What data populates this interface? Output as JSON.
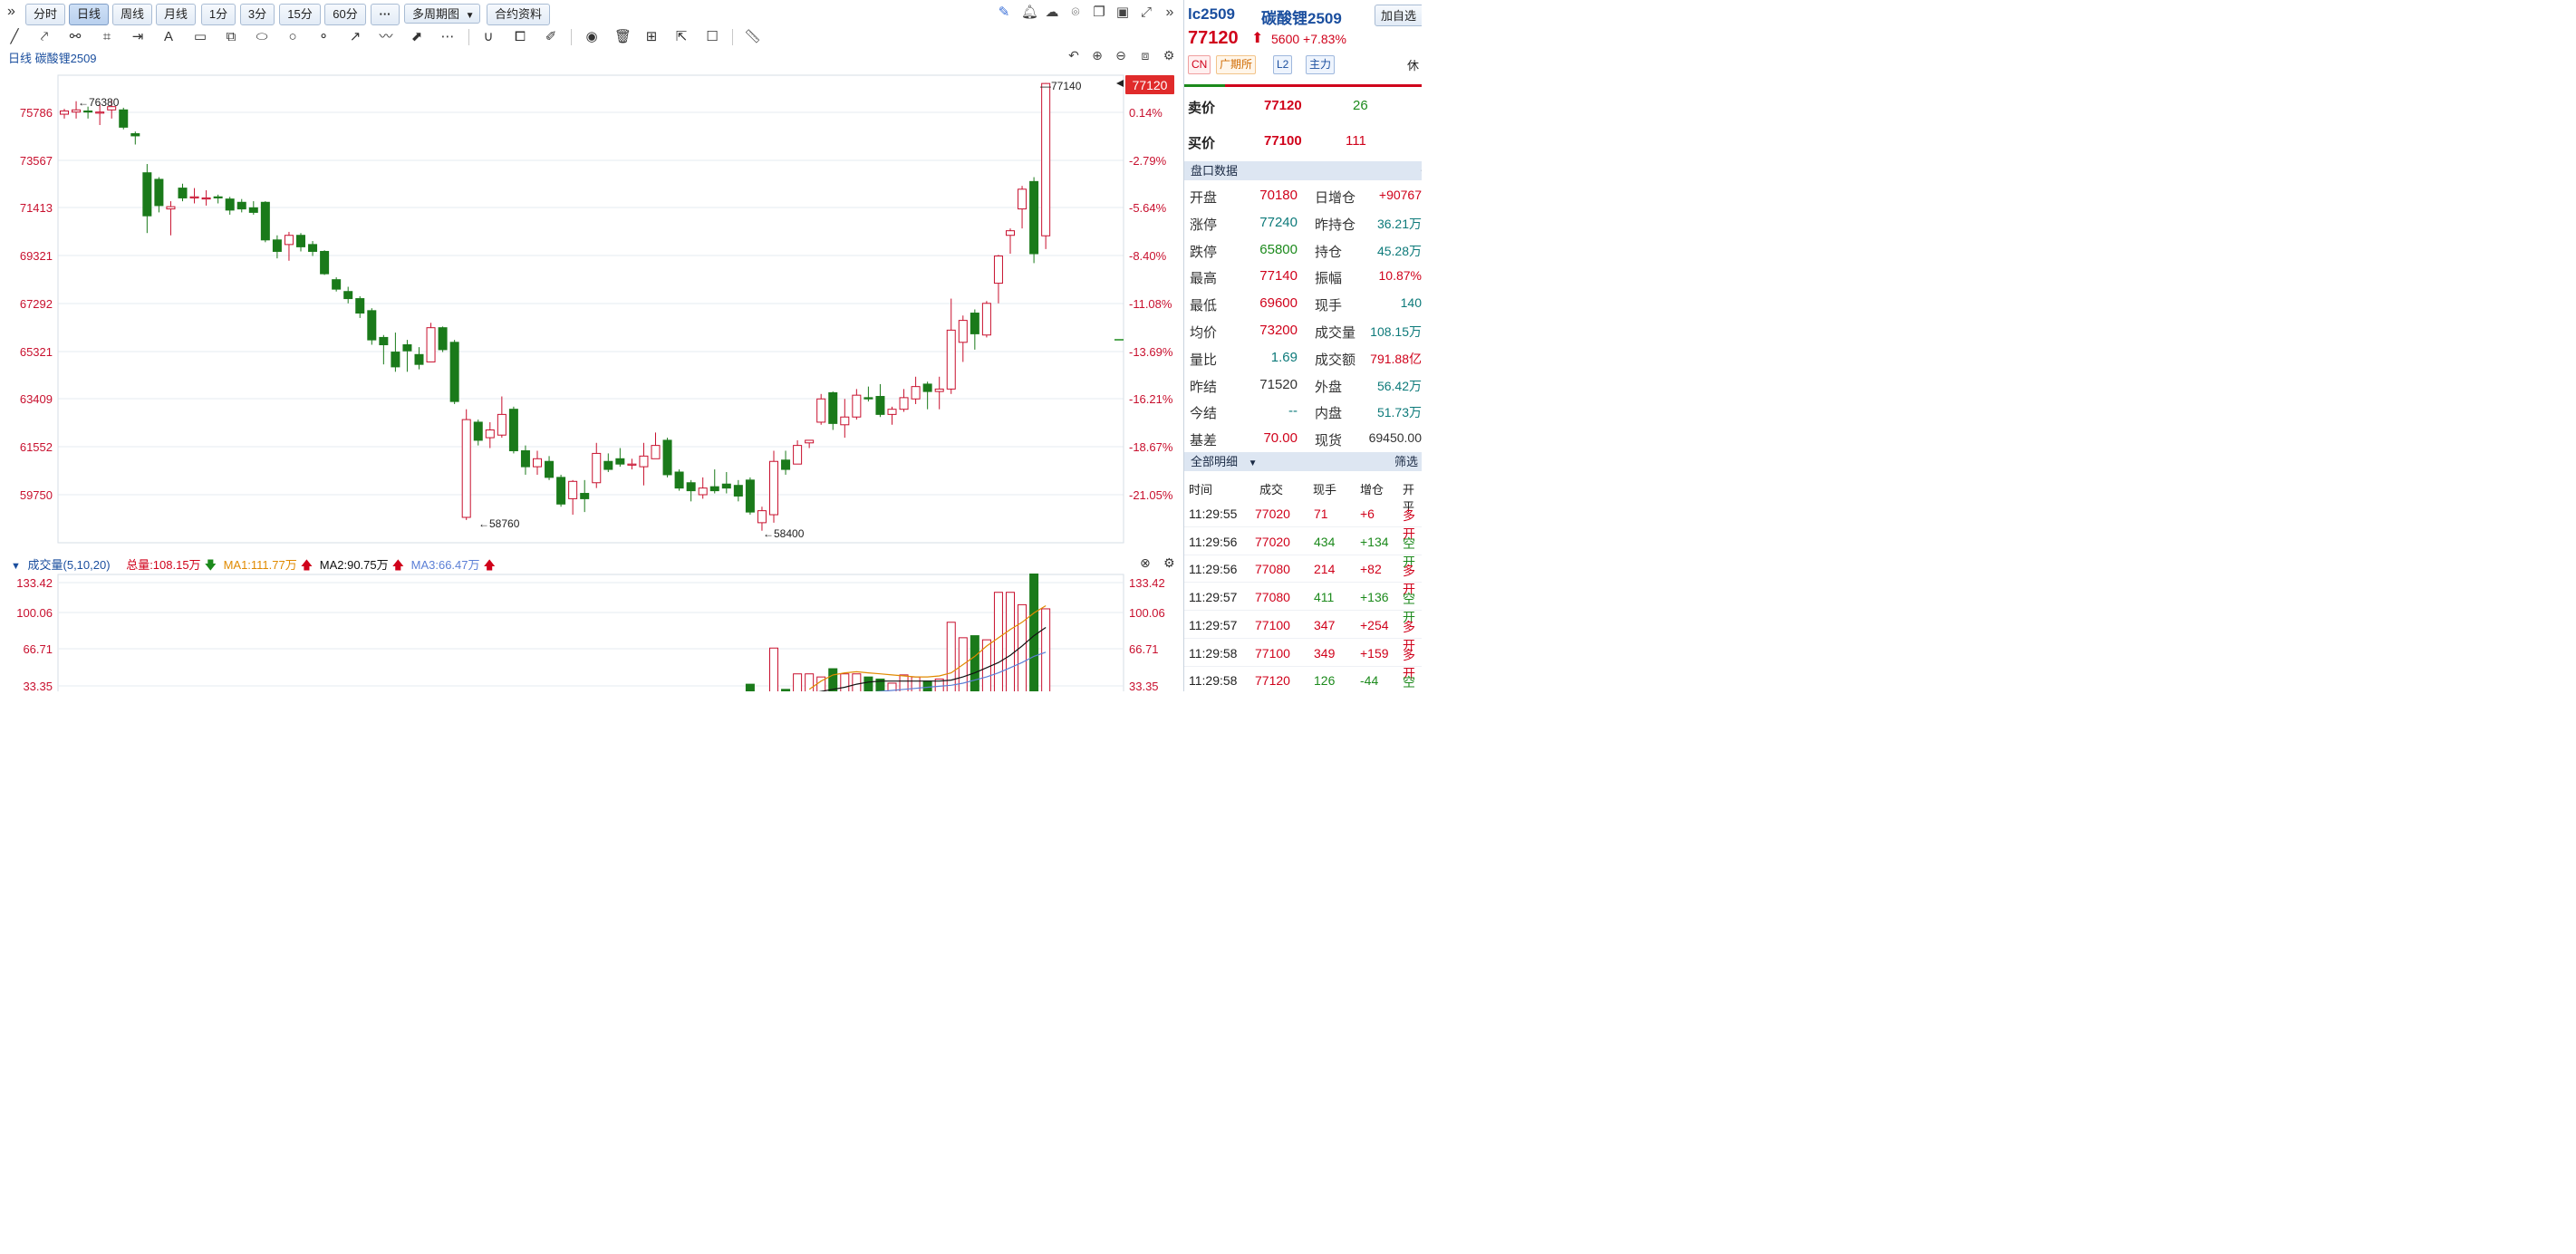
{
  "toolbar": {
    "collapse_label": "»",
    "periods": [
      "分时",
      "日线",
      "周线",
      "月线",
      "1分",
      "3分",
      "15分",
      "60分"
    ],
    "active_period": "日线",
    "more_label": "···",
    "multi_period_label": "多周期图",
    "contract_info_label": "合约资料",
    "right_icons": [
      "pencil-icon",
      "bell-icon",
      "cloud-icon",
      "camera-icon",
      "window-icon",
      "monitor-icon",
      "fullscreen-icon",
      "collapse-right-icon"
    ],
    "drawing_tools": [
      "line-tool-icon",
      "ray-tool-icon",
      "polyline-tool-icon",
      "rect-corner-tool-icon",
      "measure-tool-icon",
      "text-tool-icon",
      "comment-tool-icon",
      "parallel-tool-icon",
      "ellipse-tool-icon",
      "circle-tool-icon",
      "segment-tool-icon",
      "arrow-tool-icon",
      "wave-tool-icon",
      "price-tool-icon",
      "more-tools-icon",
      "magnet-icon",
      "copy-icon",
      "brush-icon",
      "eye-icon",
      "trash-icon",
      "grid-icon",
      "share-icon",
      "note-icon",
      "ruler-icon"
    ]
  },
  "chart": {
    "title": "日线  碳酸锂2509",
    "price_axis": [
      "75786",
      "73567",
      "71413",
      "69321",
      "67292",
      "65321",
      "63409",
      "61552",
      "59750"
    ],
    "pct_axis": [
      "0.14%",
      "-2.79%",
      "-5.64%",
      "-8.40%",
      "-11.08%",
      "-13.69%",
      "-16.21%",
      "-18.67%",
      "-21.05%"
    ],
    "current_price_tag": "77120",
    "annotations": {
      "high_left": "←76380",
      "low_mid": "←58760",
      "low_right": "←58400",
      "high_right": "—77140"
    }
  },
  "volume": {
    "header_label": "成交量(5,10,20)",
    "total": "总量:108.15万",
    "ma1": "MA1:111.77万",
    "ma2": "MA2:90.75万",
    "ma3": "MA3:66.47万",
    "axis_left": [
      "133.42",
      "100.06",
      "66.71",
      "33.35"
    ],
    "axis_right": [
      "133.42",
      "100.06",
      "66.71",
      "33.35"
    ],
    "colors": {
      "ma1": "#e08a00",
      "ma2": "#111111",
      "ma3": "#5b7fd6"
    }
  },
  "chart_data": {
    "type": "candlestick",
    "ylim": [
      58000,
      77500
    ],
    "candles": [
      [
        75700,
        75850,
        75500,
        75950
      ],
      [
        75800,
        75900,
        75500,
        76300
      ],
      [
        75850,
        75800,
        75500,
        76050
      ],
      [
        75750,
        75800,
        75200,
        76200
      ],
      [
        75900,
        76050,
        75500,
        76380
      ],
      [
        75900,
        75100,
        75000,
        76000
      ],
      [
        74800,
        74700,
        74300,
        74900
      ],
      [
        73000,
        71050,
        70300,
        73400
      ],
      [
        72700,
        71500,
        71200,
        72800
      ],
      [
        71350,
        71450,
        70200,
        71700
      ],
      [
        72300,
        71850,
        71700,
        72500
      ],
      [
        71900,
        71900,
        71600,
        72300
      ],
      [
        71850,
        71850,
        71500,
        72200
      ],
      [
        71900,
        71850,
        71600,
        72000
      ],
      [
        71800,
        71300,
        71100,
        71900
      ],
      [
        71650,
        71350,
        71200,
        71800
      ],
      [
        71400,
        71200,
        71100,
        71700
      ],
      [
        71650,
        70000,
        69900,
        71700
      ],
      [
        70000,
        69500,
        69200,
        70200
      ],
      [
        69800,
        70200,
        69100,
        70350
      ],
      [
        70200,
        69700,
        69500,
        70300
      ],
      [
        69800,
        69500,
        69300,
        69950
      ],
      [
        69500,
        68550,
        68500,
        69550
      ],
      [
        68300,
        67900,
        67800,
        68400
      ],
      [
        67800,
        67500,
        67300,
        68000
      ],
      [
        67500,
        66900,
        66700,
        67600
      ],
      [
        67000,
        65800,
        65600,
        67100
      ],
      [
        65900,
        65600,
        64800,
        66000
      ],
      [
        65300,
        64700,
        64500,
        66100
      ],
      [
        65600,
        65350,
        64500,
        65800
      ],
      [
        65200,
        64800,
        64600,
        65500
      ],
      [
        64900,
        66300,
        64900,
        66500
      ],
      [
        66300,
        65400,
        65300,
        66350
      ],
      [
        65700,
        63300,
        63200,
        65800
      ],
      [
        58900,
        62600,
        58800,
        63000
      ],
      [
        62500,
        61800,
        61600,
        62600
      ],
      [
        61900,
        62200,
        61500,
        62500
      ],
      [
        62000,
        62800,
        61900,
        63500
      ],
      [
        63000,
        61400,
        61300,
        63100
      ],
      [
        61400,
        60800,
        60500,
        61600
      ],
      [
        60800,
        61100,
        60500,
        61400
      ],
      [
        61000,
        60400,
        60300,
        61200
      ],
      [
        60400,
        59400,
        59300,
        60500
      ],
      [
        59600,
        60250,
        59000,
        60300
      ],
      [
        59800,
        59600,
        59100,
        60300
      ],
      [
        60200,
        61300,
        60000,
        61700
      ],
      [
        61000,
        60700,
        60600,
        61300
      ],
      [
        61100,
        60900,
        60800,
        61500
      ],
      [
        60900,
        60900,
        60700,
        61100
      ],
      [
        60800,
        61200,
        60100,
        61700
      ],
      [
        61100,
        61600,
        61100,
        62100
      ],
      [
        61800,
        60500,
        60400,
        61900
      ],
      [
        60600,
        60000,
        59900,
        60700
      ],
      [
        60200,
        59900,
        59500,
        60300
      ],
      [
        59750,
        60000,
        59600,
        60400
      ],
      [
        60050,
        59900,
        59800,
        60700
      ],
      [
        60150,
        60000,
        59800,
        60600
      ],
      [
        60100,
        59700,
        59500,
        60300
      ],
      [
        60300,
        59100,
        59000,
        60400
      ],
      [
        58700,
        59150,
        58400,
        59300
      ],
      [
        59000,
        61000,
        58700,
        61400
      ],
      [
        61050,
        60700,
        60500,
        61400
      ],
      [
        60900,
        61600,
        60900,
        61800
      ],
      [
        61700,
        61800,
        61500,
        61800
      ],
      [
        62500,
        63400,
        62400,
        63600
      ],
      [
        63650,
        62450,
        62200,
        63700
      ],
      [
        62400,
        62700,
        61900,
        63400
      ],
      [
        62700,
        63550,
        62600,
        63800
      ],
      [
        63450,
        63400,
        63300,
        63900
      ],
      [
        63500,
        62800,
        62700,
        64000
      ],
      [
        62800,
        63000,
        62400,
        63100
      ],
      [
        63000,
        63450,
        62900,
        63800
      ],
      [
        63400,
        63900,
        63200,
        64300
      ],
      [
        64000,
        63700,
        63000,
        64100
      ],
      [
        63700,
        63800,
        63000,
        64300
      ],
      [
        63800,
        66200,
        63600,
        67500
      ],
      [
        65700,
        66600,
        64900,
        66800
      ],
      [
        66900,
        66050,
        65400,
        67050
      ],
      [
        66000,
        67300,
        65900,
        67400
      ],
      [
        68150,
        69300,
        67300,
        69350
      ],
      [
        70200,
        70400,
        69400,
        70500
      ],
      [
        71350,
        72250,
        70500,
        72400
      ],
      [
        72600,
        69400,
        69000,
        72800
      ],
      [
        70180,
        77120,
        69600,
        77140
      ]
    ]
  },
  "right_panel": {
    "code": "lc2509",
    "name": "碳酸锂2509",
    "add_label": "加自选",
    "price": "77120",
    "arrow": "⬆",
    "change": "5600",
    "change_pct": "+7.83%",
    "tags": [
      "CN",
      "广期所",
      "L2",
      "主力"
    ],
    "status": "休",
    "sell": {
      "label": "卖价",
      "price": "77120",
      "qty": "26"
    },
    "buy": {
      "label": "买价",
      "price": "77100",
      "qty": "111"
    },
    "quote_section": "盘口数据",
    "quote_section_icon": "〈",
    "quotes": [
      {
        "l1": "开盘",
        "v1": "70180",
        "l2": "日增仓",
        "v2": "+90767"
      },
      {
        "l1": "涨停",
        "v1": "77240",
        "l2": "昨持仓",
        "v2": "36.21万"
      },
      {
        "l1": "跌停",
        "v1": "65800",
        "l2": "持仓",
        "v2": "45.28万"
      },
      {
        "l1": "最高",
        "v1": "77140",
        "l2": "振幅",
        "v2": "10.87%"
      },
      {
        "l1": "最低",
        "v1": "69600",
        "l2": "现手",
        "v2": "140"
      },
      {
        "l1": "均价",
        "v1": "73200",
        "l2": "成交量",
        "v2": "108.15万"
      },
      {
        "l1": "量比",
        "v1": "1.69",
        "l2": "成交额",
        "v2": "791.88亿"
      },
      {
        "l1": "昨结",
        "v1": "71520",
        "l2": "外盘",
        "v2": "56.42万"
      },
      {
        "l1": "今结",
        "v1": "--",
        "l2": "内盘",
        "v2": "51.73万"
      },
      {
        "l1": "基差",
        "v1": "70.00",
        "l2": "现货",
        "v2": "69450.00"
      }
    ],
    "detail_section": "全部明细",
    "detail_filter": "筛选",
    "detail_headers": [
      "时间",
      "成交",
      "现手",
      "增仓",
      "开平"
    ],
    "details": [
      {
        "time": "11:29:55",
        "price": "77020",
        "qty": "71",
        "oi": "+6",
        "type": "多开"
      },
      {
        "time": "11:29:56",
        "price": "77020",
        "qty": "434",
        "oi": "+134",
        "type": "空开"
      },
      {
        "time": "11:29:56",
        "price": "77080",
        "qty": "214",
        "oi": "+82",
        "type": "多开"
      },
      {
        "time": "11:29:57",
        "price": "77080",
        "qty": "411",
        "oi": "+136",
        "type": "空开"
      },
      {
        "time": "11:29:57",
        "price": "77100",
        "qty": "347",
        "oi": "+254",
        "type": "多开"
      },
      {
        "time": "11:29:58",
        "price": "77100",
        "qty": "349",
        "oi": "+159",
        "type": "多开"
      },
      {
        "time": "11:29:58",
        "price": "77120",
        "qty": "126",
        "oi": "-44",
        "type": "空平"
      }
    ]
  }
}
